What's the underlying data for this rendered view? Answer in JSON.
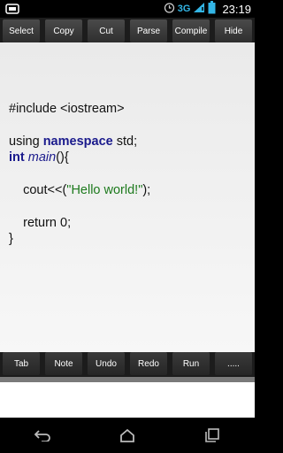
{
  "status_bar": {
    "network": "3G",
    "time": "23:19",
    "icons": [
      "notification-icon",
      "alarm-icon",
      "signal-icon",
      "battery-icon"
    ]
  },
  "top_toolbar": [
    "Select",
    "Copy",
    "Cut",
    "Parse",
    "Compile",
    "Hide"
  ],
  "bottom_toolbar": [
    "Tab",
    "Note",
    "Undo",
    "Redo",
    "Run",
    "....."
  ],
  "code": {
    "l1": "#include <iostream>",
    "l3a": "using ",
    "l3b": "namespace",
    "l3c": " std;",
    "l4a": "int",
    "l4b": " ",
    "l4c": "main",
    "l4d": "(){",
    "l6a": "    cout<<(",
    "l6b": "\"Hello world!\"",
    "l6c": ");",
    "l8": "    return 0;",
    "l9": "}"
  },
  "nav": [
    "back-icon",
    "home-icon",
    "recents-icon"
  ],
  "colors": {
    "keyword": "#1a1a8c",
    "string": "#1d7a1d",
    "accent": "#33b5e5"
  }
}
